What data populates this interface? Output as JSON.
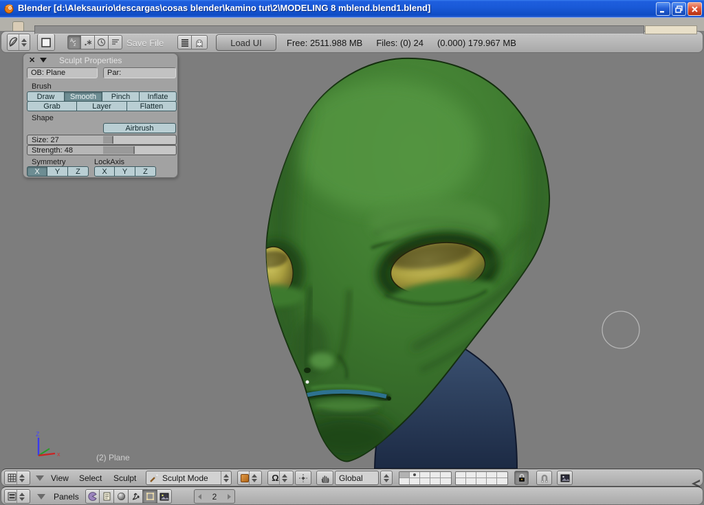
{
  "window_title": "Blender [d:\\Aleksaurio\\descargas\\cosas blender\\kamino tut\\2\\MODELING 8 mblend.blend1.blend]",
  "file_header": {
    "save_file_label": "Save File",
    "load_ui_button": "Load UI",
    "free_memory": "Free: 2511.988 MB",
    "files_count": "Files: (0) 24",
    "mem_stat": "(0.000) 179.967 MB"
  },
  "sculpt_panel": {
    "title": "Sculpt Properties",
    "ob_field": "OB: Plane",
    "par_field": "Par:",
    "brush_label": "Brush",
    "brushes": [
      "Draw",
      "Smooth",
      "Pinch",
      "Inflate",
      "Grab",
      "Layer",
      "Flatten"
    ],
    "active_brush": "Smooth",
    "shape_label": "Shape",
    "airbrush_button": "Airbrush",
    "size_slider": "Size: 27",
    "strength_slider": "Strength: 48",
    "symmetry_label": "Symmetry",
    "lockaxis_label": "LockAxis",
    "symmetry_axes": [
      "X",
      "Y",
      "Z"
    ],
    "active_symmetry": "X",
    "lock_axes": [
      "X",
      "Y",
      "Z"
    ]
  },
  "viewport": {
    "object_info": "(2) Plane",
    "axis_z_label": "Z",
    "axis_x_label": "x"
  },
  "view3d_header": {
    "menus": [
      "View",
      "Select",
      "Sculpt"
    ],
    "mode_dropdown": "Sculpt Mode",
    "orientation_dropdown": "Global",
    "pivot_icon_glyph": "Ω"
  },
  "buttons_header": {
    "panels_label": "Panels",
    "frame_value": "2"
  },
  "colors": {
    "titlebar_blue": "#1a5ad8",
    "header_grey": "#b4b4b4",
    "viewport_grey": "#7d7d7d",
    "toggle_cyan": "#b9ced3",
    "toggle_active": "#6d8d93",
    "head_green": "#3e7a2f",
    "eye_olive": "#b3aa41",
    "mouth_teal": "#2e7290",
    "neck_blue": "#2a3a5e"
  }
}
